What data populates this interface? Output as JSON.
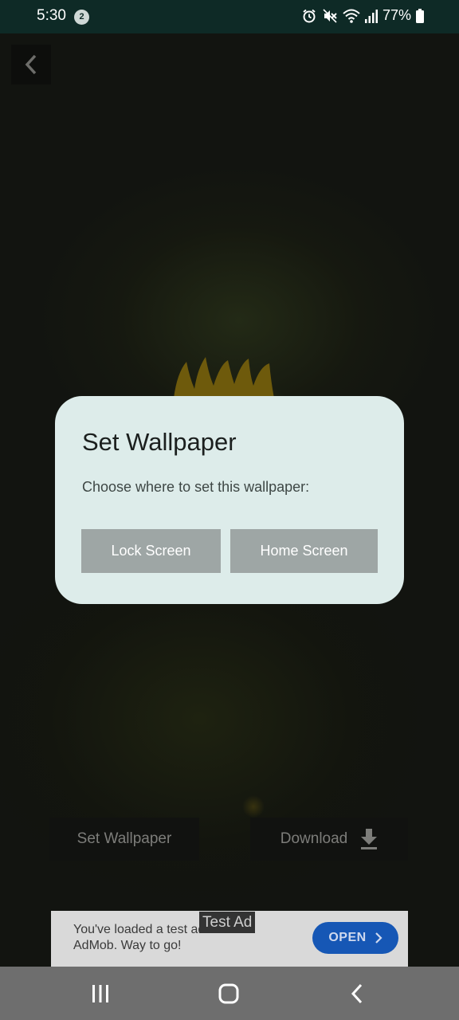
{
  "status_bar": {
    "time": "5:30",
    "notification_count": "2",
    "battery": "77%"
  },
  "dialog": {
    "title": "Set Wallpaper",
    "message": "Choose where to set this wallpaper:",
    "lock_label": "Lock Screen",
    "home_label": "Home Screen"
  },
  "actions": {
    "set_wallpaper_label": "Set Wallpaper",
    "download_label": "Download"
  },
  "ad": {
    "label": "Test Ad",
    "text": "You've loaded a test ad from AdMob. Way to go!",
    "open_label": "OPEN"
  },
  "icons": {
    "back": "chevron-left-icon",
    "download": "download-icon",
    "alarm": "alarm-icon",
    "mute": "mute-icon",
    "wifi": "wifi-icon",
    "signal": "signal-icon",
    "battery": "battery-icon",
    "nav_recents": "recents-icon",
    "nav_home": "home-icon",
    "nav_back": "back-icon"
  },
  "colors": {
    "status_bar": "#0e2a26",
    "dialog_bg": "#ddecea",
    "dialog_button": "#9ea6a5",
    "ad_button": "#1657b5",
    "nav_bar": "#6e6e6e"
  }
}
